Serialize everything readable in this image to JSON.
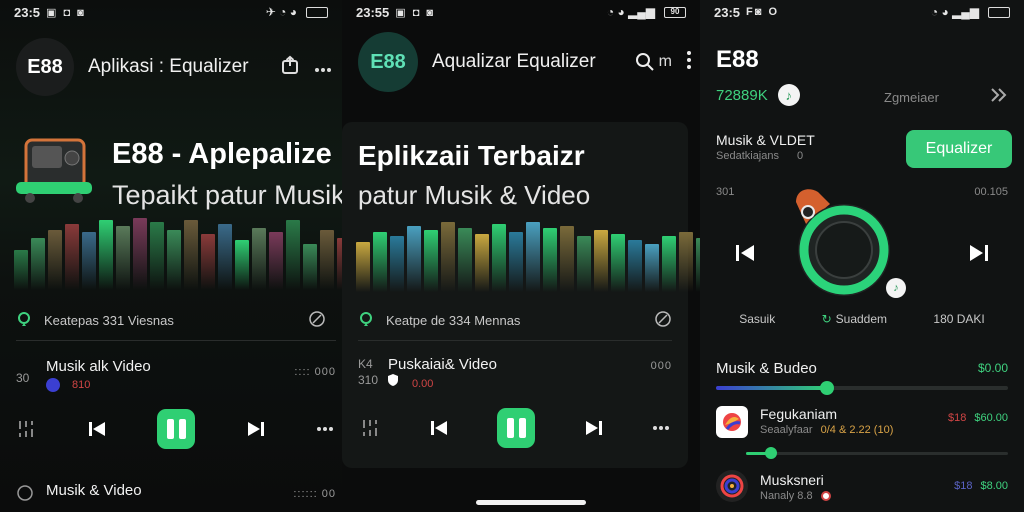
{
  "panel1": {
    "status": {
      "time": "23:5",
      "icons": "▣ ◘ ◙",
      "signal": "✈ ◔ ◕",
      "battery": ""
    },
    "appbar": {
      "logo": "E88",
      "title": "Aplikasi : Equalizer",
      "share_icon": "share-icon",
      "more_icon": "more-icon"
    },
    "hero": {
      "title": "E88 - Aplepalize",
      "subtitle": "Tepaikt patur Musik"
    },
    "meta": {
      "text": "Keatepas 331 Viesnas"
    },
    "tracks": [
      {
        "num": "30",
        "name": "Musik alk Video",
        "sub": "810",
        "right": "::::  000"
      },
      {
        "num": "",
        "name": "Musik & Video",
        "sub": "",
        "right": "::::::  00"
      }
    ]
  },
  "panel2": {
    "status": {
      "time": "23:55",
      "icons": "▣ ◘ ◙",
      "signal": "◔ ◕ ▂▄▆",
      "battery": "90"
    },
    "appbar": {
      "logo": "E88",
      "title": "Aqualizar Equalizer",
      "search_icon": "search-icon",
      "search_suffix": "m",
      "more_icon": "more-vertical-icon"
    },
    "hero": {
      "title": "Eplikzaii Terbaizr",
      "subtitle": "patur Musik & Video"
    },
    "meta": {
      "text": "Keatpe de 334 Mennas"
    },
    "track": {
      "num": "K4",
      "name": "Puskaiai& Video",
      "num2": "310",
      "sub": "0.00",
      "right": "000"
    }
  },
  "panel3": {
    "status": {
      "time": "23:5",
      "icons": "F◙ O",
      "signal": "◔ ◕ ▂▄▆",
      "battery": ""
    },
    "appbar": {
      "logo": "E88"
    },
    "stats": {
      "value": "72889K",
      "label": "Zgmeiaer"
    },
    "section": {
      "title": "Musik & VLDET",
      "sub": "Sedatkiajans",
      "count": "0",
      "button": "Equalizer"
    },
    "dial": {
      "left": "301",
      "right": "00.105"
    },
    "modes": [
      "Sasuik",
      "Suaddem",
      "180 DAKI"
    ],
    "progress_section": {
      "title": "Musik & Budeo",
      "value": "$0.00",
      "fill": 0.38
    },
    "items": [
      {
        "name": "Fegukaniam",
        "sub": "Seaalyfaar",
        "badges": "0/4  &  2.22 (10)",
        "price_red": "$18",
        "price": "$60.00",
        "fill": 0.1
      },
      {
        "name": "Musksneri",
        "sub": "Nanaly 8.8",
        "price_red": "$18",
        "price": "$8.00"
      }
    ]
  },
  "colors": {
    "accent": "#3fd27f",
    "button": "#37c878",
    "alert": "#d04545",
    "bg": "#0b0c0c"
  }
}
